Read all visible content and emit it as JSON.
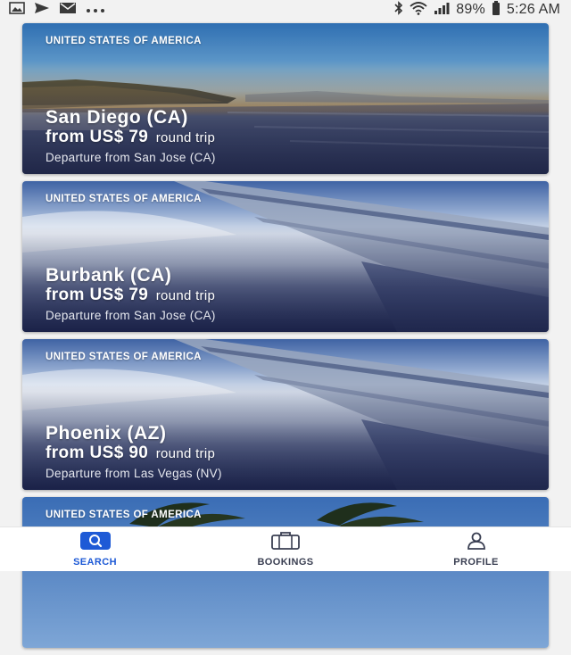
{
  "status_bar": {
    "left_icons": [
      "image-icon",
      "send-icon",
      "mail-icon",
      "more-icon"
    ],
    "bluetooth": "bluetooth-icon",
    "wifi": "wifi-icon",
    "signal": "signal-icon",
    "battery_percent": "89%",
    "battery": "battery-icon",
    "time": "5:26 AM"
  },
  "cards": [
    {
      "country": "UNITED STATES OF AMERICA",
      "city": "San Diego (CA)",
      "price": "from US$ 79",
      "trip_type": "round trip",
      "departure": "Departure from San Jose (CA)"
    },
    {
      "country": "UNITED STATES OF AMERICA",
      "city": "Burbank (CA)",
      "price": "from US$ 79",
      "trip_type": "round trip",
      "departure": "Departure from San Jose (CA)"
    },
    {
      "country": "UNITED STATES OF AMERICA",
      "city": "Phoenix (AZ)",
      "price": "from US$ 90",
      "trip_type": "round trip",
      "departure": "Departure from Las Vegas (NV)"
    },
    {
      "country": "UNITED STATES OF AMERICA"
    }
  ],
  "bottom_nav": {
    "items": [
      {
        "label": "SEARCH",
        "icon": "search-icon",
        "active": true
      },
      {
        "label": "BOOKINGS",
        "icon": "briefcase-icon",
        "active": false
      },
      {
        "label": "PROFILE",
        "icon": "user-icon",
        "active": false
      }
    ]
  },
  "colors": {
    "accent": "#1e5ad6",
    "nav_text": "#3a3f52"
  }
}
